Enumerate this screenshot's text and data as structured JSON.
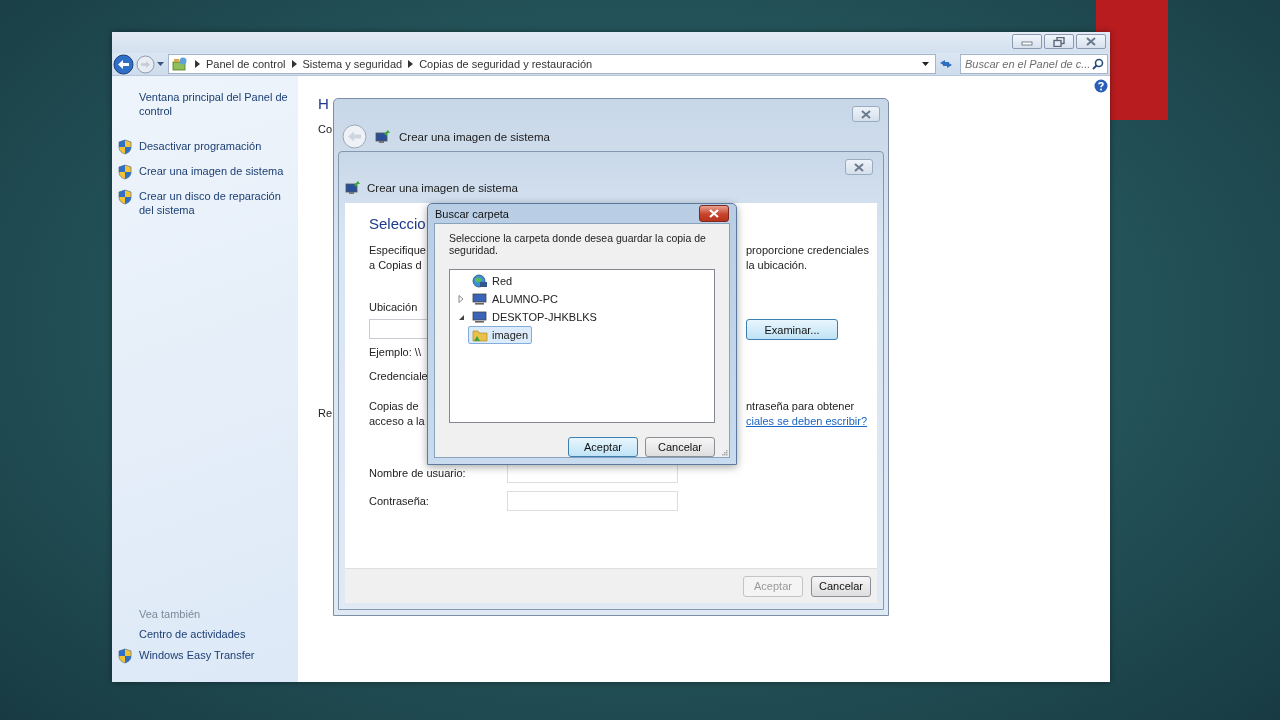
{
  "explorer": {
    "breadcrumb": [
      "Panel de control",
      "Sistema y seguridad",
      "Copias de seguridad y restauración"
    ],
    "search": {
      "placeholder": "Buscar en el Panel de c..."
    },
    "sidebar": {
      "items": [
        {
          "label": "Ventana principal del Panel de control",
          "kind": "link"
        },
        {
          "label": "Desactivar programación",
          "kind": "shield"
        },
        {
          "label": "Crear una imagen de sistema",
          "kind": "shield"
        },
        {
          "label": "Crear un disco de reparación del sistema",
          "kind": "shield"
        }
      ],
      "see_also_heading": "Vea también",
      "see_also": [
        {
          "label": "Centro de actividades",
          "kind": "link"
        },
        {
          "label": "Windows Easy Transfer",
          "kind": "shield"
        }
      ]
    },
    "content": {
      "heading": "H",
      "line_1": "Co",
      "line_2": "Re"
    }
  },
  "wizard": {
    "title": "Crear una imagen de sistema"
  },
  "page": {
    "title": "Crear una imagen de sistema",
    "heading": "Seleccio",
    "rows": [
      {
        "kind": "paragraph",
        "left": [
          "Especifique",
          "a Copias d"
        ],
        "right": [
          "proporcione credenciales",
          "la ubicación."
        ]
      },
      {
        "kind": "label",
        "left": [
          "Ubicación"
        ]
      },
      {
        "kind": "field_button",
        "button": "Examinar..."
      },
      {
        "kind": "label",
        "left": [
          "Ejemplo: \\\\"
        ]
      },
      {
        "kind": "label",
        "left": [
          "Credenciale"
        ]
      },
      {
        "kind": "paragraph",
        "left": [
          "Copias de",
          "acceso a la"
        ],
        "right": [
          "ntraseña para obtener"
        ],
        "link": "ciales se deben escribir?"
      }
    ],
    "fields": [
      {
        "label": "Nombre de usuario:"
      },
      {
        "label": "Contraseña:"
      }
    ],
    "buttons": [
      {
        "label": "Aceptar",
        "disabled": true
      },
      {
        "label": "Cancelar",
        "disabled": false
      }
    ]
  },
  "folder_dialog": {
    "title": "Buscar carpeta",
    "prompt": "Seleccione la carpeta donde desea guardar la copia de seguridad.",
    "tree": [
      {
        "label": "Red",
        "kind": "network",
        "selected": false
      },
      {
        "label": "ALUMNO-PC",
        "kind": "computer",
        "expanded": false,
        "selected": false
      },
      {
        "label": "DESKTOP-JHKBLKS",
        "kind": "computer",
        "expanded": true,
        "selected": false,
        "children": [
          {
            "label": "imagen",
            "kind": "folder",
            "selected": true
          }
        ]
      }
    ],
    "buttons": [
      {
        "label": "Aceptar",
        "default": true
      },
      {
        "label": "Cancelar",
        "default": false
      }
    ]
  }
}
